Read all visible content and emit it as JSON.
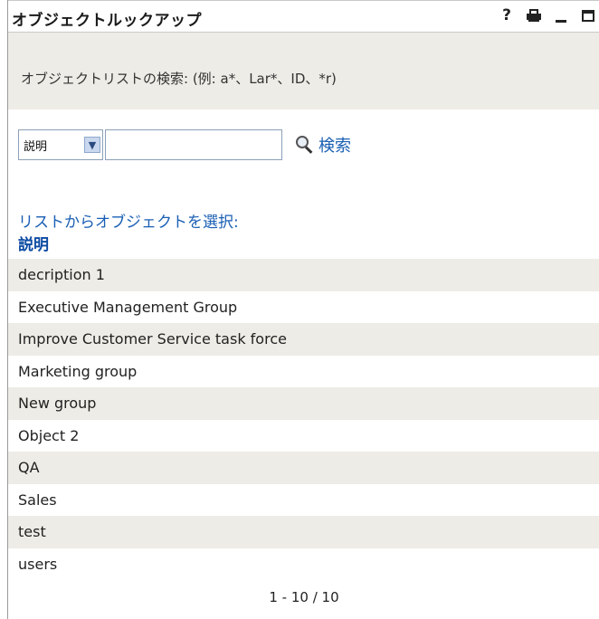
{
  "window": {
    "title": "オブジェクトルックアップ",
    "icons": [
      "help-icon",
      "print-icon",
      "minimize-icon",
      "maximize-icon"
    ],
    "help_glyph": "?"
  },
  "info": {
    "text": "オブジェクトリストの検索: (例: a*、Lar*、ID、*r)"
  },
  "search": {
    "field_select_value": "説明",
    "input_value": "",
    "button_label": "検索"
  },
  "list": {
    "heading": "リストからオブジェクトを選択:",
    "column_header": "説明",
    "items": [
      "decription 1",
      "Executive Management Group",
      "Improve Customer Service task force",
      "Marketing group",
      "New group",
      "Object 2",
      "QA",
      "Sales",
      "test",
      "users"
    ]
  },
  "pagination": {
    "text": "1 - 10 / 10"
  },
  "colors": {
    "link": "#1a5fb4",
    "header": "#0b4aa2",
    "stripe": "#eeece6"
  }
}
